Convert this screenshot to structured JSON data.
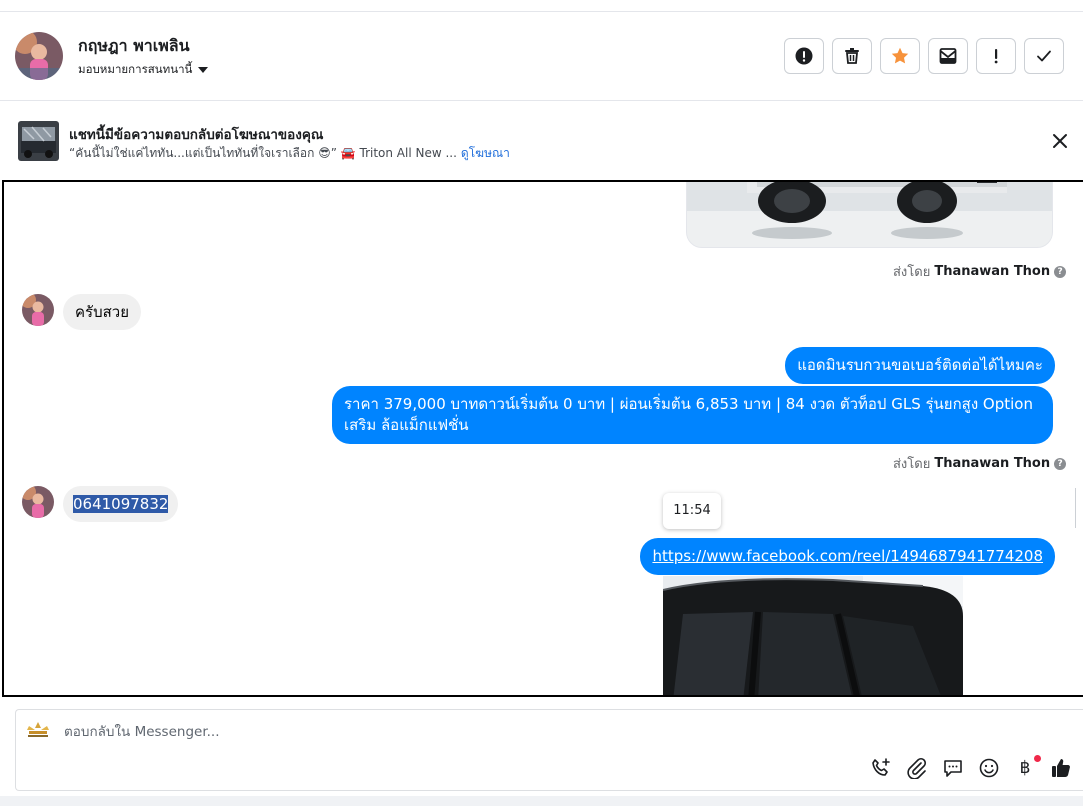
{
  "header": {
    "contact_name": "กฤษฎา พาเพลิน",
    "assign_label": "มอบหมายการสนทนานี้",
    "actions": [
      {
        "name": "report-button",
        "icon": "alert-circle-icon"
      },
      {
        "name": "delete-button",
        "icon": "trash-icon"
      },
      {
        "name": "star-button",
        "icon": "star-icon"
      },
      {
        "name": "mark-unread-button",
        "icon": "envelope-icon"
      },
      {
        "name": "spam-button",
        "icon": "exclamation-icon"
      },
      {
        "name": "done-button",
        "icon": "check-icon"
      }
    ],
    "star_color": "#f7923b"
  },
  "ad_banner": {
    "title": "แชทนี้มีข้อความตอบกลับต่อโฆษณาของคุณ",
    "subtitle": "“คันนี้ไม่ใช่แค่ไททัน...แต่เป็นไททันที่ใจเราเลือก 😎” 🚘 Triton All New ...",
    "link_label": "ดูโฆษณา"
  },
  "messages": {
    "sent_by_prefix": "ส่งโดย",
    "sender_name": "Thanawan Thon",
    "incoming_1": "ครับสวย",
    "outgoing_1": "แอดมินรบกวนขอเบอร์ติดต่อได้ไหมคะ",
    "outgoing_2": "ราคา 379,000 บาทดาวน์เริ่มต้น 0 บาท | ผ่อนเริ่มต้น 6,853 บาท | 84 งวด ตัวท็อป GLS รุ่นยกสูง Option เสริม ล้อแม็กแฟชั่น",
    "incoming_2": "0641097832",
    "tooltip_time": "11:54",
    "outgoing_link": "https://www.facebook.com/reel/1494687941774208"
  },
  "composer": {
    "placeholder": "ตอบกลับใน Messenger...",
    "tools": [
      "call-add-icon",
      "paperclip-icon",
      "saved-reply-icon",
      "emoji-icon",
      "baht-icon",
      "like-icon"
    ],
    "baht_symbol": "฿"
  },
  "colors": {
    "outgoing_bubble": "#0084ff",
    "incoming_bubble": "#f0f0f0",
    "link": "#216fdb",
    "notification_dot": "#f02849"
  }
}
